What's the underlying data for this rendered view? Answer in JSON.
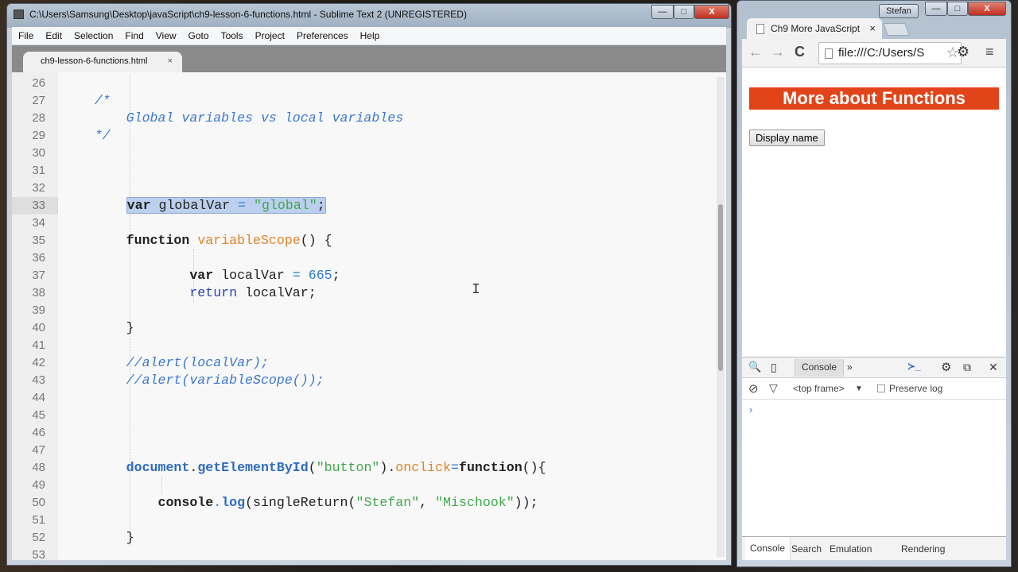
{
  "sublime": {
    "title": "C:\\Users\\Samsung\\Desktop\\javaScript\\ch9-lesson-6-functions.html - Sublime Text 2 (UNREGISTERED)",
    "menu": [
      "File",
      "Edit",
      "Selection",
      "Find",
      "View",
      "Goto",
      "Tools",
      "Project",
      "Preferences",
      "Help"
    ],
    "tab": "ch9-lesson-6-functions.html",
    "tab_close": "×",
    "window_buttons": [
      "—",
      "□",
      "X"
    ],
    "current_line": 33,
    "lines": [
      {
        "n": 26,
        "t": []
      },
      {
        "n": 27,
        "t": [
          [
            "cm",
            "    /*"
          ]
        ]
      },
      {
        "n": 28,
        "t": [
          [
            "cm",
            "        Global variables vs local variables"
          ]
        ]
      },
      {
        "n": 29,
        "t": [
          [
            "cm",
            "    */"
          ]
        ]
      },
      {
        "n": 30,
        "t": []
      },
      {
        "n": 31,
        "t": []
      },
      {
        "n": 32,
        "t": []
      },
      {
        "n": 33,
        "t": [
          [
            "pl",
            "        "
          ],
          [
            "sel",
            [
              [
                "kw",
                "var"
              ],
              [
                "pl",
                " globalVar "
              ],
              [
                "op",
                "="
              ],
              [
                "pl",
                " "
              ],
              [
                "str",
                "\"global\""
              ],
              [
                "pl",
                ";"
              ]
            ]
          ]
        ]
      },
      {
        "n": 34,
        "t": []
      },
      {
        "n": 35,
        "t": [
          [
            "pl",
            "        "
          ],
          [
            "kw",
            "function"
          ],
          [
            "pl",
            " "
          ],
          [
            "fn",
            "variableScope"
          ],
          [
            "pl",
            "() {"
          ]
        ]
      },
      {
        "n": 36,
        "t": []
      },
      {
        "n": 37,
        "t": [
          [
            "pl",
            "                "
          ],
          [
            "kw",
            "var"
          ],
          [
            "pl",
            " localVar "
          ],
          [
            "op",
            "="
          ],
          [
            "pl",
            " "
          ],
          [
            "num",
            "665"
          ],
          [
            "pl",
            ";"
          ]
        ]
      },
      {
        "n": 38,
        "t": [
          [
            "pl",
            "                "
          ],
          [
            "ret",
            "return"
          ],
          [
            "pl",
            " localVar;"
          ]
        ]
      },
      {
        "n": 39,
        "t": []
      },
      {
        "n": 40,
        "t": [
          [
            "pl",
            "        }"
          ]
        ]
      },
      {
        "n": 41,
        "t": []
      },
      {
        "n": 42,
        "t": [
          [
            "cm",
            "        //alert(localVar);"
          ]
        ]
      },
      {
        "n": 43,
        "t": [
          [
            "cm",
            "        //alert(variableScope());"
          ]
        ]
      },
      {
        "n": 44,
        "t": []
      },
      {
        "n": 45,
        "t": []
      },
      {
        "n": 46,
        "t": []
      },
      {
        "n": 47,
        "t": []
      },
      {
        "n": 48,
        "t": [
          [
            "pl",
            "        "
          ],
          [
            "bi",
            "document"
          ],
          [
            "pl",
            "."
          ],
          [
            "bi",
            "getElementById"
          ],
          [
            "pl",
            "("
          ],
          [
            "str",
            "\"button\""
          ],
          [
            "pl",
            ")."
          ],
          [
            "pr",
            "onclick"
          ],
          [
            "op",
            "="
          ],
          [
            "kw",
            "function"
          ],
          [
            "pl",
            "(){"
          ]
        ]
      },
      {
        "n": 49,
        "t": []
      },
      {
        "n": 50,
        "t": [
          [
            "pl",
            "            "
          ],
          [
            "kw",
            "console"
          ],
          [
            "op",
            "."
          ],
          [
            "bi",
            "log"
          ],
          [
            "pl",
            "(singleReturn("
          ],
          [
            "str",
            "\"Stefan\""
          ],
          [
            "pl",
            ", "
          ],
          [
            "str",
            "\"Mischook\""
          ],
          [
            "pl",
            "));"
          ]
        ]
      },
      {
        "n": 51,
        "t": []
      },
      {
        "n": 52,
        "t": [
          [
            "pl",
            "        }"
          ]
        ]
      },
      {
        "n": 53,
        "t": []
      }
    ]
  },
  "chrome": {
    "user": "Stefan",
    "window_buttons": [
      "—",
      "□",
      "X"
    ],
    "tab": "Ch9 More JavaScript",
    "tab_close": "×",
    "url": "file:///C:/Users/S",
    "nav": {
      "back": "←",
      "forward": "→",
      "reload": "C",
      "star": "☆",
      "settings": "⚙",
      "menu": "≡"
    },
    "page": {
      "heading": "More about Functions",
      "button": "Display name"
    },
    "devtools": {
      "icons": {
        "search": "🔍",
        "device": "▯",
        "more": "»",
        "console_drawer": "≻_",
        "settings": "⚙",
        "dock": "⧉",
        "close": "✕"
      },
      "active_tab": "Console",
      "clear_icon": "⊘",
      "filter_icon": "▽",
      "frame": "<top frame>",
      "frame_arrow": "▼",
      "preserve_log": "Preserve log",
      "preserve_checked": false,
      "prompt": "›",
      "drawer_tabs": [
        "Console",
        "Search",
        "Emulation",
        "Rendering"
      ]
    }
  }
}
